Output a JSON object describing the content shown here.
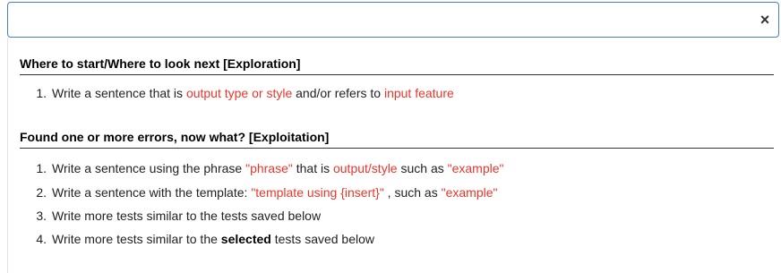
{
  "header": {
    "close_icon": "×"
  },
  "exploration": {
    "title": "Where to start/Where to look next [Exploration]",
    "items": [
      {
        "num": "1.",
        "p1": "Write a sentence that is ",
        "r1": "output type or style",
        "p2": " and/or refers to ",
        "r2": "input feature"
      }
    ]
  },
  "exploitation": {
    "title": "Found one or more errors, now what? [Exploitation]",
    "items": [
      {
        "num": "1.",
        "p1": "Write a sentence using the phrase ",
        "r1": "\"phrase\"",
        "p2": " that is ",
        "r2": "output/style",
        "p3": " such as ",
        "r3": "\"example\""
      },
      {
        "num": "2.",
        "p1": "Write a sentence with the template: ",
        "r1": "\"template using {insert}\"",
        "p2": " , such as ",
        "r2": "\"example\""
      },
      {
        "num": "3.",
        "p1": "Write more tests similar to the tests saved below"
      },
      {
        "num": "4.",
        "p1": "Write more tests similar to the ",
        "b1": "selected",
        "p2": " tests saved below"
      }
    ]
  },
  "colors": {
    "accent_red": "#e8362b",
    "border_blue": "#4a7fc8"
  }
}
